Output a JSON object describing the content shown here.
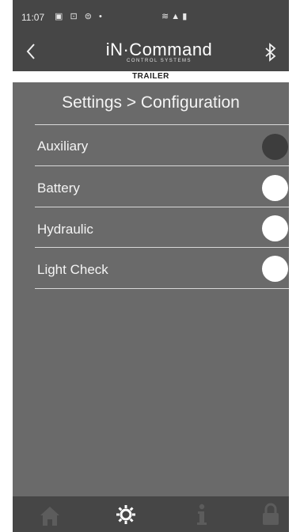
{
  "status_bar": {
    "time": "11:07",
    "left_icons": "▣ ⊡ ⊜ •",
    "right_icons": "≋ ▲ ▮"
  },
  "header": {
    "back_icon": "chevron-left-icon",
    "brand_title": "iN·Command",
    "brand_subtitle": "CONTROL SYSTEMS",
    "bluetooth_icon": "bluetooth-icon"
  },
  "subheader": {
    "label": "TRAILER"
  },
  "page": {
    "title": "Settings > Configuration"
  },
  "settings": [
    {
      "label": "Auxiliary",
      "enabled": false
    },
    {
      "label": "Battery",
      "enabled": true
    },
    {
      "label": "Hydraulic",
      "enabled": true
    },
    {
      "label": "Light Check",
      "enabled": true
    }
  ],
  "bottom_nav": [
    {
      "icon": "home-icon",
      "active": false
    },
    {
      "icon": "gear-icon",
      "active": true
    },
    {
      "icon": "info-icon",
      "active": false
    },
    {
      "icon": "lock-icon",
      "active": false
    }
  ],
  "colors": {
    "background": "#6a6a6a",
    "bar": "#464646",
    "toggle_on": "#ffffff",
    "toggle_off": "#3d3d3d",
    "nav_active": "#ffffff",
    "nav_inactive": "#5c5c5c"
  }
}
